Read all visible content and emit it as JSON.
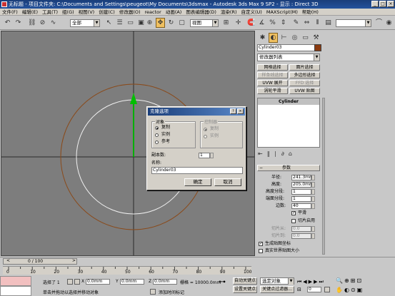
{
  "window": {
    "title": "无标题 - 项目文件夹: C:\\Documents and Settings\\peugeot\\My Documents\\3dsmax - Autodesk 3ds Max 9 SP2 - 显示 : Direct 3D",
    "min": "_",
    "max": "□",
    "close": "×"
  },
  "menu": [
    "文件(F)",
    "编辑(E)",
    "工具(T)",
    "组(G)",
    "视图(V)",
    "创建(C)",
    "修改器(O)",
    "reactor",
    "动画(A)",
    "图表编辑器(D)",
    "渲染(R)",
    "自定义(U)",
    "MAXScript(M)",
    "帮助(H)"
  ],
  "toolbar": {
    "selection_filter": "全部",
    "ref_coord": "视图",
    "named_selection": ""
  },
  "panel": {
    "object_name": "Cylinder03",
    "object_color": "#8a3a10",
    "modifier_list": "修改器列表",
    "mod_buttons": [
      {
        "label": "网格选择",
        "enabled": true
      },
      {
        "label": "面片选择",
        "enabled": true
      },
      {
        "label": "样条线选择",
        "enabled": false
      },
      {
        "label": "多边形选择",
        "enabled": true
      },
      {
        "label": "UVW 展开",
        "enabled": true
      },
      {
        "label": "FFD 选择",
        "enabled": false
      },
      {
        "label": "涡轮平滑",
        "enabled": true
      },
      {
        "label": "UVW 贴图",
        "enabled": true
      }
    ],
    "stack_item": "Cylinder",
    "rollout_title": "参数",
    "params": {
      "radius_label": "半径:",
      "radius": "241.3mm",
      "height_label": "高度:",
      "height": "205.0mm",
      "height_segs_label": "高度分段:",
      "height_segs": "1",
      "cap_segs_label": "端面分段:",
      "cap_segs": "1",
      "sides_label": "边数:",
      "sides": "40",
      "smooth_label": "平滑",
      "slice_on_label": "切片启用",
      "slice_from_label": "切片从:",
      "slice_from": "0.0",
      "slice_to_label": "切片到:",
      "slice_to": "0.0",
      "gen_mapping_label": "生成贴图坐标",
      "real_world_label": "真实世界贴图大小"
    }
  },
  "dialog": {
    "title": "克隆选项",
    "help": "?",
    "close": "×",
    "object_group": "对象",
    "controller_group": "控制器",
    "opt_copy": "复制",
    "opt_instance": "实例",
    "opt_reference": "参考",
    "ctrl_copy": "复制",
    "ctrl_instance": "实例",
    "copies_label": "副本数:",
    "copies": "1",
    "name_label": "名称:",
    "name": "Cylinder03",
    "ok": "确定",
    "cancel": "取消"
  },
  "timeline": {
    "frame": "0 / 100",
    "ticks": [
      "0",
      "10",
      "20",
      "30",
      "40",
      "50",
      "60",
      "70",
      "80",
      "90",
      "100"
    ],
    "selected": "选择了 1",
    "x_label": "X",
    "x": "0.0mm",
    "y_label": "Y",
    "y": "0.0mm",
    "z_label": "Z",
    "z": "0.0mm",
    "grid": "栅格 = 10000.0mm",
    "auto_key": "自动关键点",
    "set_key": "设置关键点",
    "selection_set": "选定对象",
    "key_filters": "关键点过滤器...",
    "status_msg": "单击并拖动以选择并移动对象",
    "add_time_tag": "添加时间标记",
    "frame_field": "0"
  }
}
